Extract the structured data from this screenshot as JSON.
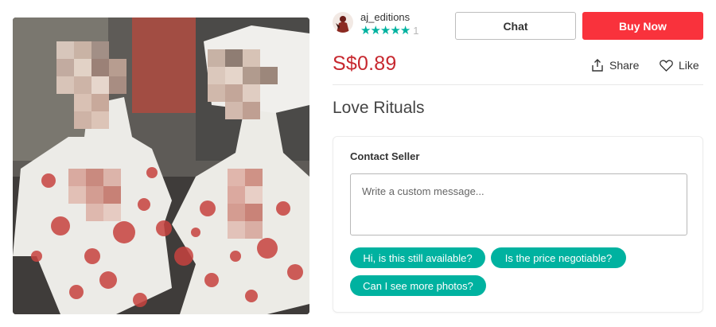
{
  "listing": {
    "photo_alt": "listing photo",
    "price": "S$0.89",
    "title": "Love Rituals"
  },
  "seller": {
    "username": "aj_editions",
    "rating_stars": 5,
    "rating_count": "1"
  },
  "actions": {
    "chat_label": "Chat",
    "buy_label": "Buy Now",
    "share_label": "Share",
    "like_label": "Like"
  },
  "contact": {
    "title": "Contact Seller",
    "message_placeholder": "Write a custom message...",
    "message_value": "",
    "quick_replies": [
      "Hi, is this still available?",
      "Is the price negotiable?",
      "Can I see more photos?"
    ]
  },
  "colors": {
    "brand_red": "#f9323c",
    "price_red": "#c7282f",
    "teal": "#00b2a0"
  },
  "icons": {
    "share": "share-icon",
    "like": "heart-icon",
    "star": "star-icon"
  }
}
